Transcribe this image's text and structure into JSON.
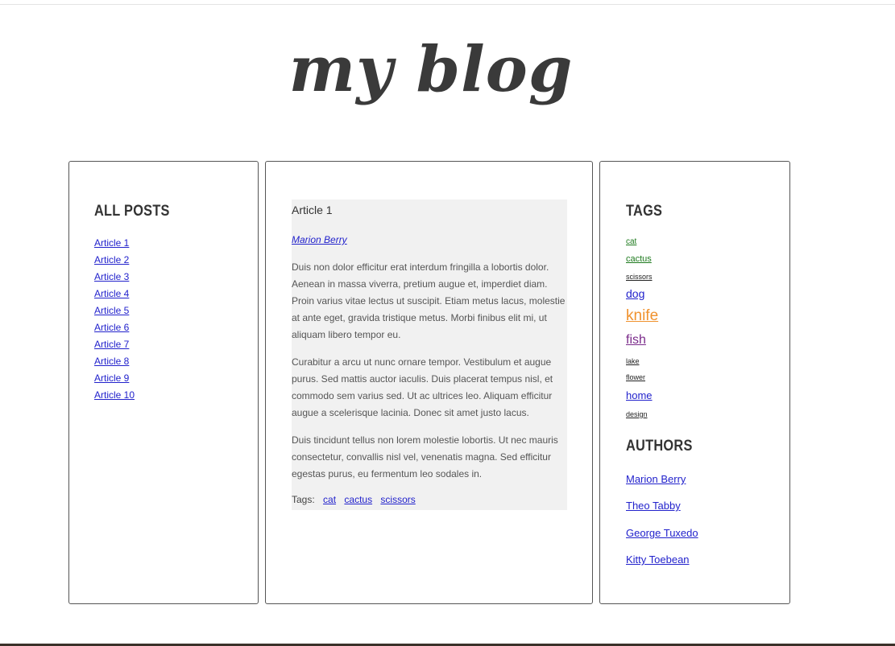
{
  "site": {
    "title": "my blog"
  },
  "sidebar_left": {
    "heading": "ALL POSTS",
    "posts": [
      "Article 1",
      "Article 2",
      "Article 3",
      "Article 4",
      "Article 5",
      "Article 6",
      "Article 7",
      "Article 8",
      "Article 9",
      "Article 10"
    ]
  },
  "article": {
    "title": "Article 1",
    "author": "Marion Berry",
    "paragraphs": [
      "Duis non dolor efficitur erat interdum fringilla a lobortis dolor. Aenean in massa viverra, pretium augue et, imperdiet diam. Proin varius vitae lectus ut suscipit. Etiam metus lacus, molestie at ante eget, gravida tristique metus. Morbi finibus elit mi, ut aliquam libero tempor eu.",
      "Curabitur a arcu ut nunc ornare tempor. Vestibulum et augue purus. Sed mattis auctor iaculis. Duis placerat tempus nisl, et commodo sem varius sed. Ut ac ultrices leo. Aliquam efficitur augue a scelerisque lacinia. Donec sit amet justo lacus.",
      "Duis tincidunt tellus non lorem molestie lobortis. Ut nec mauris consectetur, convallis nisl vel, venenatis magna. Sed efficitur egestas purus, eu fermentum leo sodales in."
    ],
    "tags_label": "Tags:",
    "tags": [
      "cat",
      "cactus",
      "scissors"
    ]
  },
  "sidebar_right": {
    "tags_heading": "TAGS",
    "tags": [
      {
        "label": "cat",
        "color": "#1e7a1e"
      },
      {
        "label": "cactus",
        "color": "#1e7a1e"
      },
      {
        "label": "scissors",
        "color": "#222222"
      },
      {
        "label": "dog",
        "color": "#2222cc"
      },
      {
        "label": "knife",
        "color": "#f0922e"
      },
      {
        "label": "fish",
        "color": "#7a2a8a"
      },
      {
        "label": "lake",
        "color": "#222222"
      },
      {
        "label": "flower",
        "color": "#222222"
      },
      {
        "label": "home",
        "color": "#2222cc"
      },
      {
        "label": "design",
        "color": "#222222"
      }
    ],
    "authors_heading": "AUTHORS",
    "authors": [
      "Marion Berry",
      "Theo Tabby",
      "George Tuxedo",
      "Kitty Toebean"
    ]
  }
}
